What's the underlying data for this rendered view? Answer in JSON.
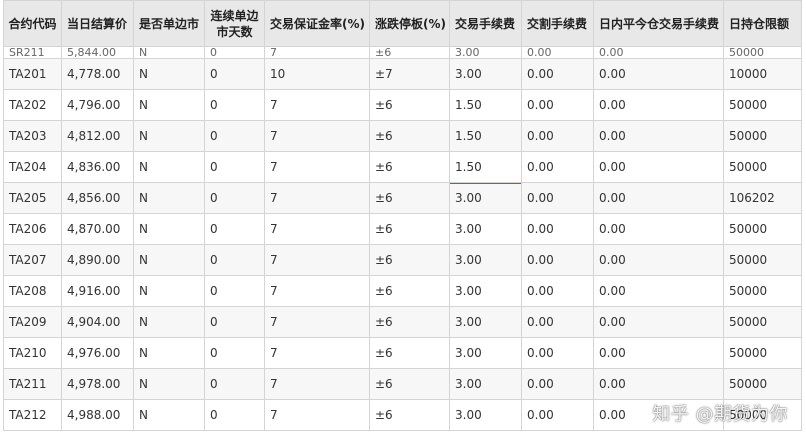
{
  "table": {
    "headers": [
      "合约代码",
      "当日结算价",
      "是否单边市",
      "连续单边市天数",
      "交易保证金率(%)",
      "涨跌停板(%)",
      "交易手续费",
      "交割手续费",
      "日内平今仓交易手续费",
      "日持仓限额"
    ],
    "partial_row": [
      "SR211",
      "5,844.00",
      "N",
      "0",
      "7",
      "±6",
      "3.00",
      "0.00",
      "0.00",
      "50000"
    ],
    "rows": [
      [
        "TA201",
        "4,778.00",
        "N",
        "0",
        "10",
        "±7",
        "3.00",
        "0.00",
        "0.00",
        "10000"
      ],
      [
        "TA202",
        "4,796.00",
        "N",
        "0",
        "7",
        "±6",
        "1.50",
        "0.00",
        "0.00",
        "50000"
      ],
      [
        "TA203",
        "4,812.00",
        "N",
        "0",
        "7",
        "±6",
        "1.50",
        "0.00",
        "0.00",
        "50000"
      ],
      [
        "TA204",
        "4,836.00",
        "N",
        "0",
        "7",
        "±6",
        "1.50",
        "0.00",
        "0.00",
        "50000"
      ],
      [
        "TA205",
        "4,856.00",
        "N",
        "0",
        "7",
        "±6",
        "3.00",
        "0.00",
        "0.00",
        "106202"
      ],
      [
        "TA206",
        "4,870.00",
        "N",
        "0",
        "7",
        "±6",
        "3.00",
        "0.00",
        "0.00",
        "50000"
      ],
      [
        "TA207",
        "4,890.00",
        "N",
        "0",
        "7",
        "±6",
        "3.00",
        "0.00",
        "0.00",
        "50000"
      ],
      [
        "TA208",
        "4,916.00",
        "N",
        "0",
        "7",
        "±6",
        "3.00",
        "0.00",
        "0.00",
        "50000"
      ],
      [
        "TA209",
        "4,904.00",
        "N",
        "0",
        "7",
        "±6",
        "3.00",
        "0.00",
        "0.00",
        "50000"
      ],
      [
        "TA210",
        "4,976.00",
        "N",
        "0",
        "7",
        "±6",
        "3.00",
        "0.00",
        "0.00",
        "50000"
      ],
      [
        "TA211",
        "4,978.00",
        "N",
        "0",
        "7",
        "±6",
        "3.00",
        "0.00",
        "0.00",
        "50000"
      ],
      [
        "TA212",
        "4,988.00",
        "N",
        "0",
        "7",
        "±6",
        "3.00",
        "0.00",
        "0.00",
        "50000"
      ]
    ],
    "highlight": {
      "row_contract": "TA205",
      "column": "交易手续费",
      "color": "#d9393a"
    }
  },
  "watermark": "知乎 @期货为你",
  "colors": {
    "header_bg": "#e8e8e8",
    "border": "#d4d4d4",
    "highlight": "#d9393a"
  }
}
